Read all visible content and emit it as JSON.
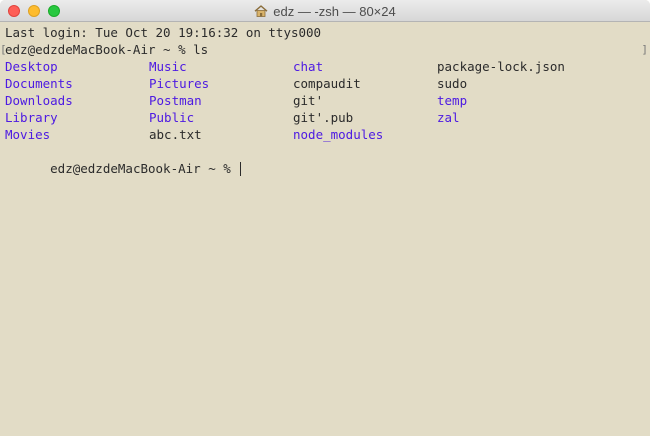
{
  "window": {
    "title": "edz — -zsh — 80×24",
    "title_icon": "home-icon",
    "controls": [
      "close",
      "minimize",
      "zoom"
    ],
    "background_color": "#e2dcc6"
  },
  "terminal": {
    "last_login": "Last login: Tue Oct 20 19:16:32 on ttys000",
    "prompt_1": "edz@edzdeMacBook-Air ~ % ls",
    "prompt_2": "edz@edzdeMacBook-Air ~ %",
    "mark_left": "[",
    "mark_right": "]",
    "directory_color": "#4e1be2",
    "file_color": "#2b2b2b",
    "ls_columns": [
      [
        {
          "name": "Desktop",
          "type": "dir"
        },
        {
          "name": "Documents",
          "type": "dir"
        },
        {
          "name": "Downloads",
          "type": "dir"
        },
        {
          "name": "Library",
          "type": "dir"
        },
        {
          "name": "Movies",
          "type": "dir"
        }
      ],
      [
        {
          "name": "Music",
          "type": "dir"
        },
        {
          "name": "Pictures",
          "type": "dir"
        },
        {
          "name": "Postman",
          "type": "dir"
        },
        {
          "name": "Public",
          "type": "dir"
        },
        {
          "name": "abc.txt",
          "type": "file"
        }
      ],
      [
        {
          "name": "chat",
          "type": "dir"
        },
        {
          "name": "compaudit",
          "type": "file"
        },
        {
          "name": "git'",
          "type": "file"
        },
        {
          "name": "git'.pub",
          "type": "file"
        },
        {
          "name": "node_modules",
          "type": "dir"
        }
      ],
      [
        {
          "name": "package-lock.json",
          "type": "file"
        },
        {
          "name": "sudo",
          "type": "file"
        },
        {
          "name": "temp",
          "type": "dir"
        },
        {
          "name": "zal",
          "type": "dir"
        }
      ]
    ]
  }
}
